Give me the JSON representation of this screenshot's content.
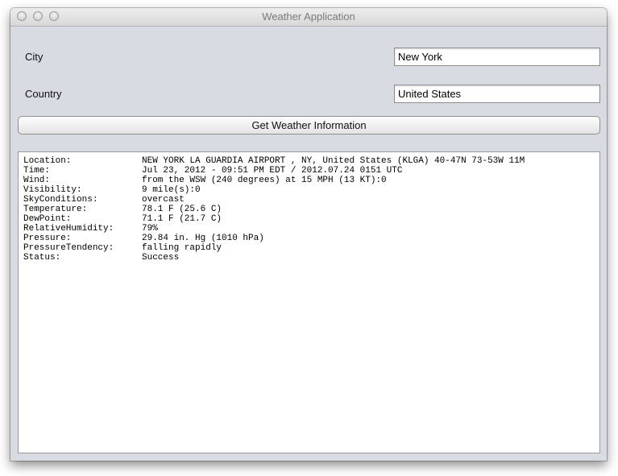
{
  "window": {
    "title": "Weather Application"
  },
  "form": {
    "city_label": "City",
    "city_value": "New York",
    "country_label": "Country",
    "country_value": "United States",
    "button_label": "Get Weather Information"
  },
  "report": [
    {
      "key": "Location:",
      "value": "NEW YORK LA GUARDIA AIRPORT , NY, United States (KLGA) 40-47N 73-53W 11M"
    },
    {
      "key": "Time:",
      "value": "Jul 23, 2012 - 09:51 PM EDT / 2012.07.24 0151 UTC"
    },
    {
      "key": "Wind:",
      "value": "from the WSW (240 degrees) at 15 MPH (13 KT):0"
    },
    {
      "key": "Visibility:",
      "value": "9 mile(s):0"
    },
    {
      "key": "SkyConditions:",
      "value": "overcast"
    },
    {
      "key": "Temperature:",
      "value": "78.1 F (25.6 C)"
    },
    {
      "key": "DewPoint:",
      "value": "71.1 F (21.7 C)"
    },
    {
      "key": "RelativeHumidity:",
      "value": "79%"
    },
    {
      "key": "Pressure:",
      "value": "29.84 in. Hg (1010 hPa)"
    },
    {
      "key": "PressureTendency:",
      "value": "falling rapidly"
    },
    {
      "key": "Status:",
      "value": "Success"
    }
  ]
}
